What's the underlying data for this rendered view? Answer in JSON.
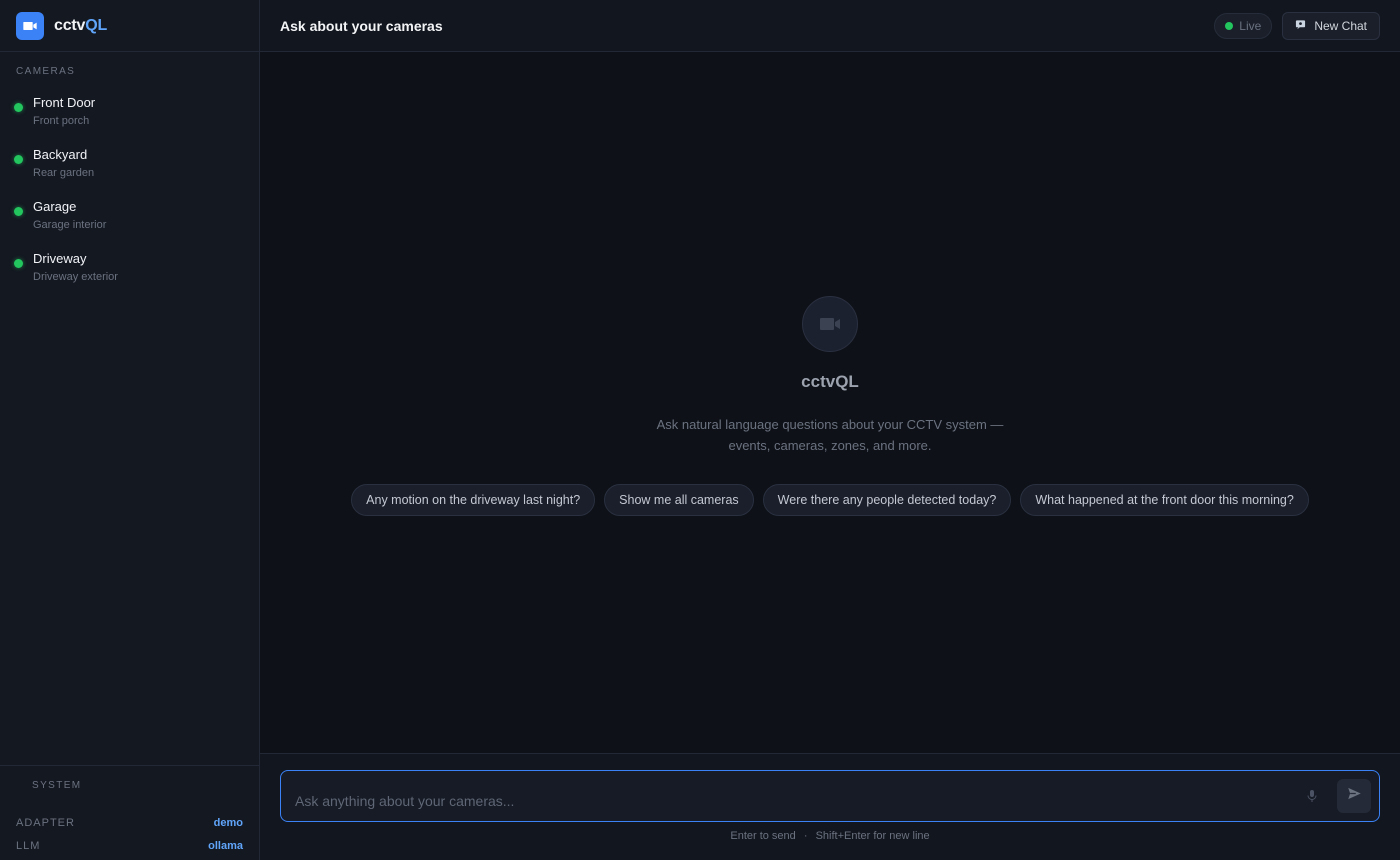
{
  "brand": {
    "name_plain": "cctv",
    "name_accent": "QL",
    "logo_icon": "video-camera-icon",
    "accent_color": "#3b82f6"
  },
  "sidebar": {
    "cameras_label": "CAMERAS",
    "cameras": [
      {
        "name": "Front Door",
        "location": "Front porch",
        "status_color": "#22c55e"
      },
      {
        "name": "Backyard",
        "location": "Rear garden",
        "status_color": "#22c55e"
      },
      {
        "name": "Garage",
        "location": "Garage interior",
        "status_color": "#22c55e"
      },
      {
        "name": "Driveway",
        "location": "Driveway exterior",
        "status_color": "#22c55e"
      }
    ],
    "system": {
      "label": "SYSTEM",
      "rows": [
        {
          "key": "ADAPTER",
          "value": "demo"
        },
        {
          "key": "LLM",
          "value": "ollama"
        }
      ]
    }
  },
  "header": {
    "title": "Ask about your cameras",
    "live_label": "Live",
    "new_chat_label": "New Chat",
    "new_chat_icon": "chat-icon"
  },
  "empty_state": {
    "icon": "video-camera-icon",
    "title": "cctvQL",
    "description": "Ask natural language questions about your CCTV system — events, cameras, zones, and more.",
    "suggestions": [
      "Any motion on the driveway last night?",
      "Show me all cameras",
      "Were there any people detected today?",
      "What happened at the front door this morning?"
    ]
  },
  "composer": {
    "placeholder": "Ask anything about your cameras...",
    "value": "",
    "mic_icon": "microphone-icon",
    "send_icon": "send-icon",
    "hint_send": "Enter to send",
    "hint_separator": "·",
    "hint_newline": "Shift+Enter for new line"
  }
}
